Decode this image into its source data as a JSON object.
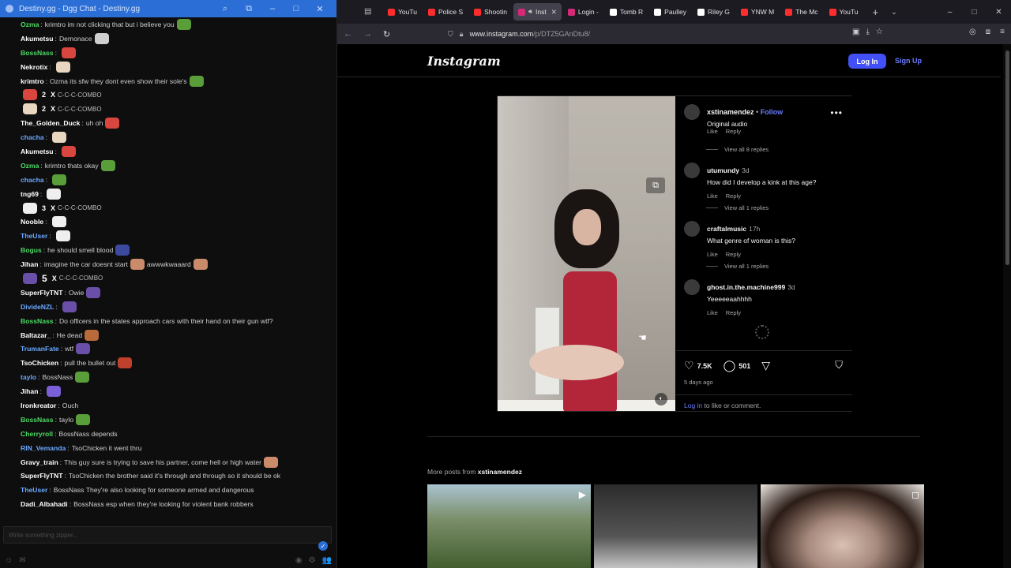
{
  "chat": {
    "window_title": "Destiny.gg - Dgg Chat - Destiny.gg",
    "input_placeholder": "Write something zipper...",
    "messages": [
      {
        "user": "Ozma",
        "color": "#4cd964",
        "text": "krimtro im not clicking that but i believe you",
        "emotes": [
          "#5a9e3a"
        ]
      },
      {
        "user": "Akumetsu",
        "color": "#ffffff",
        "text": "Demonace",
        "emotes": [
          "#cfcfcf"
        ]
      },
      {
        "user": "BossNass",
        "color": "#4cd964",
        "text": "",
        "emotes": [
          "#d9453f"
        ]
      },
      {
        "user": "Nekrotix",
        "color": "#ffffff",
        "text": "",
        "emotes": [
          "#e9d6c0"
        ]
      },
      {
        "user": "krimtro",
        "color": "#ffffff",
        "text": "Ozma its sfw they dont even show their sole's",
        "emotes": [
          "#5a9e3a"
        ]
      },
      {
        "combo": true,
        "count": "2",
        "x": "X",
        "label": "C-C-C-COMBO",
        "emote": "#d9453f"
      },
      {
        "combo": true,
        "count": "2",
        "x": "X",
        "label": "C-C-C-COMBO",
        "emote": "#e9d6c0"
      },
      {
        "user": "The_Golden_Duck",
        "color": "#ffffff",
        "text": "uh oh",
        "emotes": [
          "#d9453f"
        ]
      },
      {
        "user": "chacha",
        "color": "#6aa8ff",
        "text": "",
        "emotes": [
          "#e9d6c0"
        ]
      },
      {
        "user": "Akumetsu",
        "color": "#ffffff",
        "text": "",
        "emotes": [
          "#d9453f"
        ]
      },
      {
        "user": "Ozma",
        "color": "#4cd964",
        "text": "krimtro thats okay",
        "emotes": [
          "#5a9e3a"
        ]
      },
      {
        "user": "chacha",
        "color": "#6aa8ff",
        "text": "",
        "emotes": [
          "#5a9e3a"
        ]
      },
      {
        "user": "tng69",
        "color": "#ffffff",
        "text": "",
        "emotes": [
          "#efefef"
        ]
      },
      {
        "combo": true,
        "count": "3",
        "x": "X",
        "label": "C-C-C-COMBO",
        "emote": "#efefef"
      },
      {
        "user": "Nooble",
        "color": "#ffffff",
        "text": "",
        "emotes": [
          "#efefef"
        ]
      },
      {
        "user": "TheUser",
        "color": "#6aa8ff",
        "text": "",
        "emotes": [
          "#efefef"
        ]
      },
      {
        "user": "Bogus",
        "color": "#4cd964",
        "text": "he should smell blood",
        "emotes": [
          "#3b4a9e"
        ]
      },
      {
        "user": "Jihan",
        "color": "#ffffff",
        "text": "imagine the car doesnt start",
        "emotes": [
          "#c98b6a"
        ],
        "after": "awwwkwaaard",
        "after_emote": "#c98b6a"
      },
      {
        "combo": true,
        "count": "5",
        "x": "X",
        "label": "C-C-C-COMBO",
        "emote": "#6a4fa8",
        "big": true
      },
      {
        "user": "SuperFlyTNT",
        "color": "#ffffff",
        "text": "Owie",
        "emotes": [
          "#6a4fa8"
        ]
      },
      {
        "user": "DivideNZL",
        "color": "#6aa8ff",
        "text": "",
        "emotes": [
          "#6a4fa8"
        ]
      },
      {
        "user": "BossNass",
        "color": "#4cd964",
        "text": "Do officers in the states approach cars with their hand on their gun wtf?",
        "emotes": []
      },
      {
        "user": "Baltazar_",
        "color": "#ffffff",
        "text": "He dead",
        "emotes": [
          "#b86a3a"
        ]
      },
      {
        "user": "TrumanFate",
        "color": "#6aa8ff",
        "text": "wtf",
        "emotes": [
          "#6a4fa8"
        ]
      },
      {
        "user": "TsoChicken",
        "color": "#ffffff",
        "text": "pull the bullet out",
        "emotes": [
          "#c0402e"
        ]
      },
      {
        "user": "taylo",
        "color": "#6aa8ff",
        "text": "BossNass",
        "emotes": [
          "#5a9e3a"
        ]
      },
      {
        "user": "Jihan",
        "color": "#ffffff",
        "text": "",
        "emotes": [
          "#7a5fd8"
        ]
      },
      {
        "user": "Ironkreator",
        "color": "#ffffff",
        "text": "Ouch",
        "emotes": []
      },
      {
        "user": "BossNass",
        "color": "#4cd964",
        "text": "taylo",
        "emotes": [
          "#5a9e3a"
        ]
      },
      {
        "user": "Cherryroll",
        "color": "#4cd964",
        "text": "BossNass depends",
        "emotes": []
      },
      {
        "user": "RIN_Vemanda",
        "color": "#6aa8ff",
        "text": "TsoChicken it went thru",
        "emotes": []
      },
      {
        "user": "Gravy_train",
        "color": "#ffffff",
        "text": "This guy sure is trying to save his partner, come hell or high water",
        "emotes": [
          "#c98b6a"
        ]
      },
      {
        "user": "SuperFlyTNT",
        "color": "#ffffff",
        "text": "TsoChicken the brother said it's through and through so it should be ok",
        "emotes": []
      },
      {
        "user": "TheUser",
        "color": "#6aa8ff",
        "text": "BossNass They're also looking for someone armed and dangerous",
        "emotes": []
      },
      {
        "user": "Dadi_Albahadi",
        "color": "#ffffff",
        "text": "BossNass esp when they're looking for violent bank robbers",
        "emotes": []
      }
    ]
  },
  "browser": {
    "tabs": [
      {
        "label": "YouTu",
        "color": "#ff2d2d",
        "active": false
      },
      {
        "label": "Police S",
        "color": "#ff2d2d",
        "active": false
      },
      {
        "label": "Shootin",
        "color": "#ff2d2d",
        "active": false
      },
      {
        "label": "Inst",
        "color": "#d62976",
        "active": true
      },
      {
        "label": "Login -",
        "color": "#d62976",
        "active": false
      },
      {
        "label": "Tomb R",
        "color": "#ffffff",
        "active": false
      },
      {
        "label": "Paulley",
        "color": "#ffffff",
        "active": false
      },
      {
        "label": "Riley G",
        "color": "#ffffff",
        "active": false
      },
      {
        "label": "YNW M",
        "color": "#ff2d2d",
        "active": false
      },
      {
        "label": "The Mc",
        "color": "#ff2d2d",
        "active": false
      },
      {
        "label": "YouTu",
        "color": "#ff2d2d",
        "active": false
      }
    ],
    "url_host": "www.instagram.com",
    "url_path": "/p/DTZ5GAnDtu8/"
  },
  "instagram": {
    "logo": "Instagram",
    "login_label": "Log In",
    "signup_label": "Sign Up",
    "author": "xstinamendez",
    "follow_label": "Follow",
    "audio_label": "Original audio",
    "first_like": "Like",
    "first_reply": "Reply",
    "first_view_replies": "View all 8 replies",
    "comments": [
      {
        "user": "utumundy",
        "time": "3d",
        "text": "How did I develop a kink at this age?",
        "like": "Like",
        "reply": "Reply",
        "view": "View all 1 replies"
      },
      {
        "user": "craftalmusic",
        "time": "17h",
        "text": "What genre of woman is this?",
        "like": "Like",
        "reply": "Reply",
        "view": "View all 1 replies"
      },
      {
        "user": "ghost.in.the.machine999",
        "time": "3d",
        "text": "Yeeeeeaahhhh",
        "like": "Like",
        "reply": "Reply",
        "view": ""
      }
    ],
    "likes": "7.5K",
    "comments_count": "501",
    "date": "5 days ago",
    "login_link": "Log in",
    "login_rest": "to like or comment.",
    "more_posts_prefix": "More posts from",
    "more_posts_user": "xstinamendez"
  }
}
